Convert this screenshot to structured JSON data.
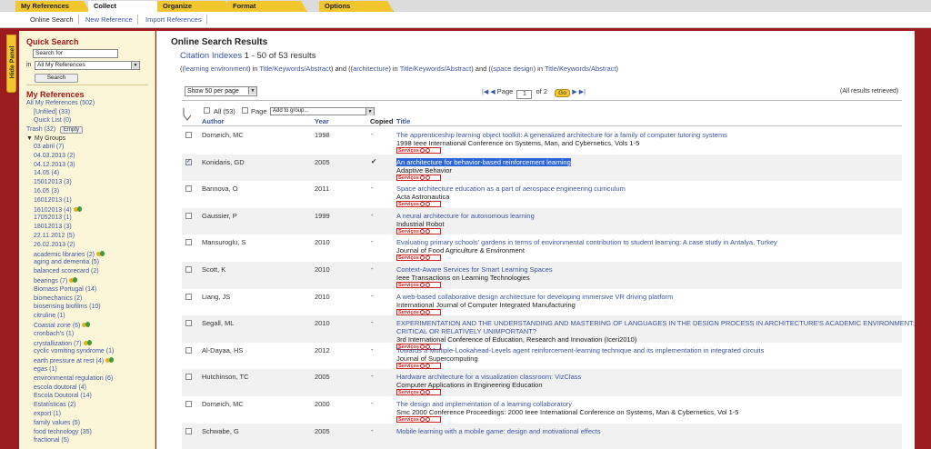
{
  "tabs": [
    "My References",
    "Collect",
    "Organize",
    "Format",
    "Options"
  ],
  "active_tab": "Collect",
  "subnav": [
    "Online Search",
    "New Reference",
    "Import References"
  ],
  "hide_panel_label": "Hide Panel",
  "sidebar": {
    "quick_search_title": "Quick Search",
    "search_value": "Search for",
    "in_label": "in",
    "scope_value": "All My References",
    "search_button": "Search",
    "my_references_title": "My References",
    "all_refs": "All My References",
    "all_refs_count": "(502)",
    "unfiled": "[Unfiled]",
    "unfiled_count": "(33)",
    "quick_list": "Quick List",
    "quick_list_count": "(0)",
    "trash": "Trash",
    "trash_count": "(32)",
    "empty_button": "Empty",
    "my_groups": "My Groups",
    "groups": [
      {
        "name": "03 abril",
        "count": "(7)",
        "shared": false
      },
      {
        "name": "04.03.2013",
        "count": "(2)",
        "shared": false
      },
      {
        "name": "04.12.2013",
        "count": "(3)",
        "shared": false
      },
      {
        "name": "14.05",
        "count": "(4)",
        "shared": false
      },
      {
        "name": "15012013",
        "count": "(3)",
        "shared": false
      },
      {
        "name": "16.05",
        "count": "(3)",
        "shared": false
      },
      {
        "name": "16012013",
        "count": "(1)",
        "shared": false
      },
      {
        "name": "16102013",
        "count": "(4)",
        "shared": true
      },
      {
        "name": "17052013",
        "count": "(1)",
        "shared": false
      },
      {
        "name": "18012013",
        "count": "(3)",
        "shared": false
      },
      {
        "name": "22.11.2012",
        "count": "(5)",
        "shared": false
      },
      {
        "name": "26.02.2013",
        "count": "(2)",
        "shared": false
      },
      {
        "name": "academic libraries",
        "count": "(2)",
        "shared": true
      },
      {
        "name": "aging and dementia",
        "count": "(5)",
        "shared": false
      },
      {
        "name": "balanced scorecard",
        "count": "(2)",
        "shared": false
      },
      {
        "name": "bearings",
        "count": "(7)",
        "shared": true
      },
      {
        "name": "Biomass Portugal",
        "count": "(14)",
        "shared": false
      },
      {
        "name": "biomechanics",
        "count": "(2)",
        "shared": false
      },
      {
        "name": "biosensing biofilms",
        "count": "(10)",
        "shared": false
      },
      {
        "name": "citruline",
        "count": "(1)",
        "shared": false
      },
      {
        "name": "Coastal zone",
        "count": "(6)",
        "shared": true
      },
      {
        "name": "cronbach's",
        "count": "(1)",
        "shared": false
      },
      {
        "name": "crystallization",
        "count": "(7)",
        "shared": true
      },
      {
        "name": "cyclic vomiting syndrome",
        "count": "(1)",
        "shared": false
      },
      {
        "name": "earth pressure at rest",
        "count": "(4)",
        "shared": true
      },
      {
        "name": "egas",
        "count": "(1)",
        "shared": false
      },
      {
        "name": "environmental regulation",
        "count": "(6)",
        "shared": false
      },
      {
        "name": "escola doutoral",
        "count": "(4)",
        "shared": false
      },
      {
        "name": "Escola Doutoral",
        "count": "(14)",
        "shared": false
      },
      {
        "name": "Estatísticas",
        "count": "(2)",
        "shared": false
      },
      {
        "name": "export",
        "count": "(1)",
        "shared": false
      },
      {
        "name": "family values",
        "count": "(5)",
        "shared": false
      },
      {
        "name": "food technology",
        "count": "(35)",
        "shared": false
      },
      {
        "name": "fractional",
        "count": "(5)",
        "shared": false
      }
    ]
  },
  "main": {
    "title": "Online Search Results",
    "source": "Citation Indexes",
    "range": "1 - 50 of 53 results",
    "query": {
      "term1": "learning environment",
      "field1": "Title/Keywords/Abstract",
      "and1": "and",
      "term2": "architecture",
      "field2": "Title/Keywords/Abstract",
      "and2": "and",
      "term3": "space design",
      "field3": "Title/Keywords/Abstract"
    },
    "show_per_page": "Show 50 per page",
    "page_label": "Page",
    "page_value": "1",
    "page_of": "of",
    "page_total": "2",
    "go_button": "Go",
    "retrieved": "(All results retrieved)",
    "all_label": "All (53)",
    "page_check_label": "Page",
    "add_to_group": "Add to group...",
    "col_author": "Author",
    "col_year": "Year",
    "col_copied": "Copied",
    "col_title": "Title",
    "services_label": "Serviços"
  },
  "results": [
    {
      "author": "Dorneich, MC",
      "year": "1998",
      "copied": "-",
      "checked": false,
      "title": "The apprenticeship learning object toolkit: A generalized architecture for a family of computer tutoring systems",
      "title2": "",
      "source": "1998 Ieee International Conference on Systems, Man, and Cybernetics, Vols 1-5"
    },
    {
      "author": "Konidaris, GD",
      "year": "2005",
      "copied": "✔",
      "checked": true,
      "selected": true,
      "title": "An architecture for behavior-based reinforcement learning",
      "title2": "",
      "source": "Adaptive Behavior"
    },
    {
      "author": "Bannova, O",
      "year": "2011",
      "copied": "-",
      "checked": false,
      "title": "Space architecture education as a part of aerospace engineering curriculum",
      "title2": "",
      "source": "Acta Astronautica"
    },
    {
      "author": "Gaussier, P",
      "year": "1999",
      "copied": "-",
      "checked": false,
      "title": "A neural architecture for autonomous learning",
      "title2": "",
      "source": "Industrial Robot"
    },
    {
      "author": "Mansuroglu, S",
      "year": "2010",
      "copied": "-",
      "checked": false,
      "title": "Evaluating primary schools' gardens in terms of environmental contribution to student learning: A case study in Antalya, Turkey",
      "title2": "",
      "source": "Journal of Food Agriculture & Environment"
    },
    {
      "author": "Scott, K",
      "year": "2010",
      "copied": "-",
      "checked": false,
      "title": "Context-Aware Services for Smart Learning Spaces",
      "title2": "",
      "source": "Ieee Transactions on Learning Technologies"
    },
    {
      "author": "Liang, JS",
      "year": "2010",
      "copied": "-",
      "checked": false,
      "title": "A web-based collaborative design architecture for developing immersive VR driving platform",
      "title2": "",
      "source": "International Journal of Computer Integrated Manufacturing"
    },
    {
      "author": "Segall, ML",
      "year": "2010",
      "copied": "-",
      "checked": false,
      "title": "EXPERIMENTATION AND THE UNDERSTANDING AND MASTERING OF LANGUAGES IN THE DESIGN PROCESS IN ARCHITECTURE'S ACADEMIC ENVIRONMENT:",
      "title2": "CRITICAL OR RELATIVELY UNIMPORTANT?",
      "source": "3rd International Conference of Education, Research and Innovation (Iceri2010)"
    },
    {
      "author": "Al-Dayaa, HS",
      "year": "2012",
      "copied": "-",
      "checked": false,
      "title": "Towards a Multiple-Lookahead-Levels agent reinforcement-learning technique and its implementation in integrated circuits",
      "title2": "",
      "source": "Journal of Supercomputing"
    },
    {
      "author": "Hutchinson, TC",
      "year": "2005",
      "copied": "-",
      "checked": false,
      "title": "Hardware architecture for a visualization classroom: VizClass",
      "title2": "",
      "source": "Computer Applications in Engineering Education"
    },
    {
      "author": "Dorneich, MC",
      "year": "2000",
      "copied": "-",
      "checked": false,
      "title": "The design and implementation of a learning collaboratory",
      "title2": "",
      "source": "Smc 2000 Conference Proceedings: 2000 Ieee International Conference on Systems, Man & Cybernetics, Vol 1-5"
    },
    {
      "author": "Schwabe, G",
      "year": "2005",
      "copied": "-",
      "checked": false,
      "title": "Mobile learning with a mobile game: design and motivational effects",
      "title2": "",
      "source": ""
    }
  ]
}
